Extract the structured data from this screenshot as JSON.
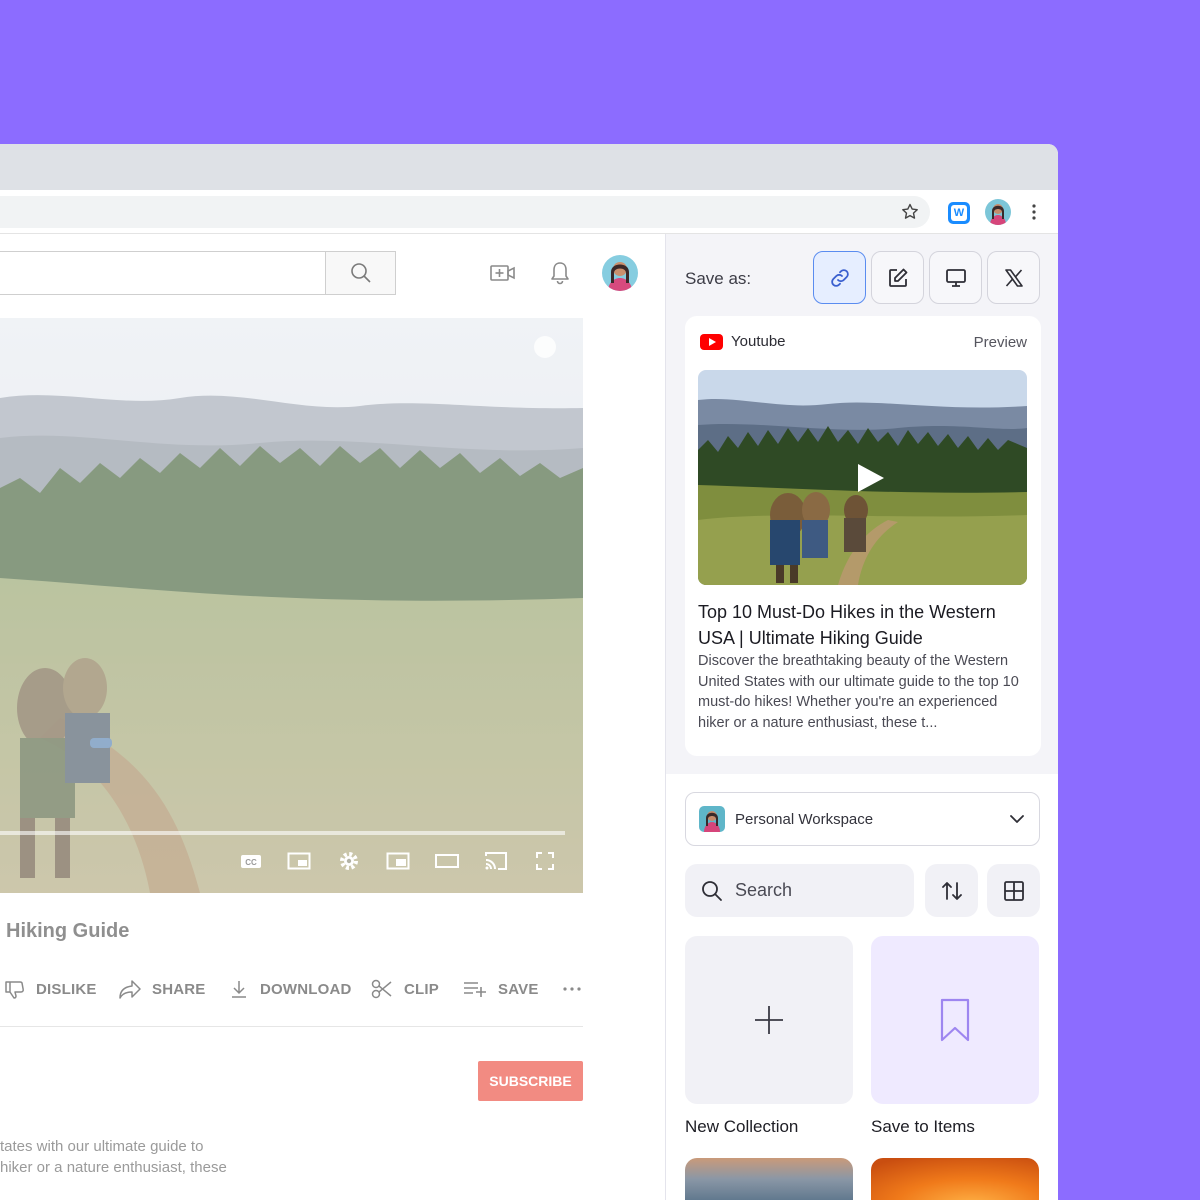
{
  "browser": {
    "star_icon": "star-icon",
    "extension_icon": "W",
    "menu_icon": "more-vert-icon"
  },
  "youtube": {
    "search_icon": "search-icon",
    "create_icon": "video-plus-icon",
    "notifications_icon": "bell-icon",
    "video_title": "Hiking Guide",
    "actions": {
      "dislike": "DISLIKE",
      "share": "SHARE",
      "download": "DOWNLOAD",
      "clip": "CLIP",
      "save": "SAVE"
    },
    "controls": {
      "captions_label": "CC"
    },
    "subscribe": "SUBSCRIBE",
    "description_lines": [
      "tates with our ultimate guide to",
      "hiker or a nature enthusiast, these"
    ]
  },
  "panel": {
    "save_as_label": "Save as:",
    "save_as_options": [
      "link-icon",
      "note-edit-icon",
      "screen-icon",
      "x-logo-icon"
    ],
    "card": {
      "source": "Youtube",
      "preview_label": "Preview",
      "title": "Top 10 Must-Do Hikes in the Western USA | Ultimate Hiking Guide",
      "description": "Discover the breathtaking beauty of the Western United States with our ultimate guide to the top 10 must-do hikes! Whether you're an experienced hiker or a nature enthusiast, these t..."
    },
    "workspace": {
      "label": "Personal Workspace"
    },
    "search": {
      "placeholder": "Search"
    },
    "tiles": {
      "new_collection": "New Collection",
      "save_to_items": "Save to Items"
    }
  },
  "colors": {
    "background": "#8c6cff",
    "accent": "#5a8cf0",
    "subscribe": "#f28b82",
    "youtube_red": "#ff0000"
  }
}
